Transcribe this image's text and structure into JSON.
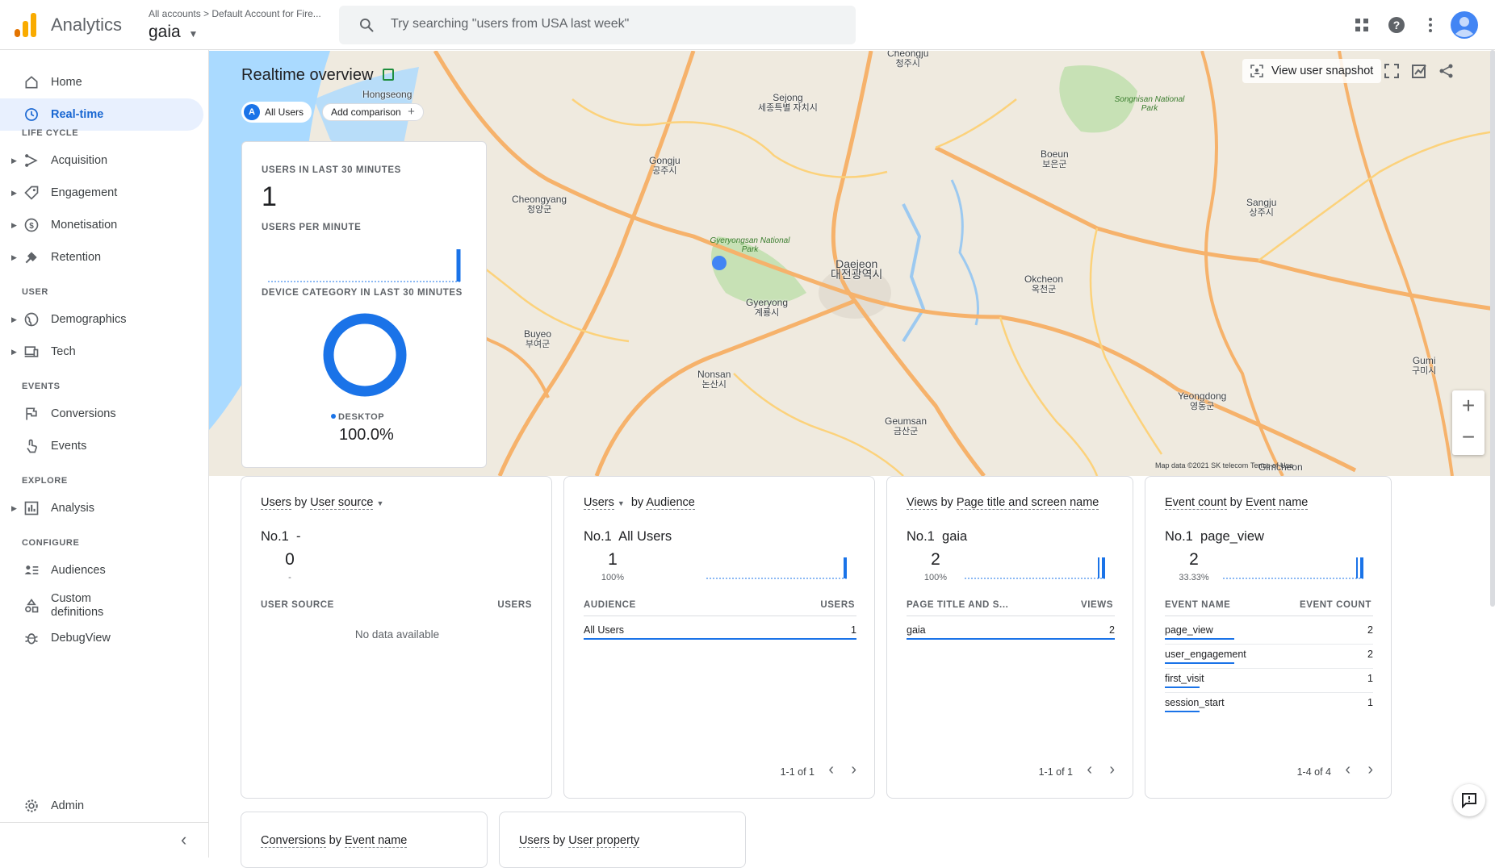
{
  "app": {
    "title": "Analytics",
    "breadcrumb": "All accounts  >  Default Account for Fire...",
    "property": "gaia",
    "search_placeholder": "Try searching \"users from USA last week\""
  },
  "colors": {
    "accent": "#1a73e8",
    "active_bg": "#e8f0fe",
    "logo_orange": "#f9ab00",
    "logo_dark": "#e37400"
  },
  "sidebar": {
    "items": [
      {
        "label": "Home",
        "icon": "home-icon"
      },
      {
        "label": "Real-time",
        "icon": "clock-icon",
        "active": true
      }
    ],
    "sections": [
      {
        "label": "LIFE CYCLE",
        "items": [
          {
            "label": "Acquisition",
            "icon": "acquisition-icon"
          },
          {
            "label": "Engagement",
            "icon": "engagement-icon"
          },
          {
            "label": "Monetisation",
            "icon": "monetisation-icon"
          },
          {
            "label": "Retention",
            "icon": "retention-icon"
          }
        ]
      },
      {
        "label": "USER",
        "items": [
          {
            "label": "Demographics",
            "icon": "globe-icon"
          },
          {
            "label": "Tech",
            "icon": "devices-icon"
          }
        ]
      },
      {
        "label": "EVENTS",
        "items": [
          {
            "label": "Conversions",
            "icon": "flag-icon"
          },
          {
            "label": "Events",
            "icon": "touch-icon"
          }
        ]
      },
      {
        "label": "EXPLORE",
        "items": [
          {
            "label": "Analysis",
            "icon": "analysis-icon"
          }
        ]
      },
      {
        "label": "CONFIGURE",
        "items": [
          {
            "label": "Audiences",
            "icon": "audiences-icon"
          },
          {
            "label": "Custom\ndefinitions",
            "icon": "custom-definitions-icon"
          },
          {
            "label": "DebugView",
            "icon": "bug-icon"
          }
        ]
      }
    ],
    "admin": "Admin"
  },
  "overview": {
    "title": "Realtime overview",
    "chip_letter": "A",
    "chip_label": "All Users",
    "add_comparison": "Add comparison",
    "view_snapshot": "View user snapshot"
  },
  "map": {
    "places": [
      [
        "Cheongju",
        "청주시"
      ],
      [
        "Sejong",
        "세종특별 자치시"
      ],
      [
        "Hongseong",
        ""
      ],
      [
        "Gongju",
        "공주시"
      ],
      [
        "Cheongyang",
        "청양군"
      ],
      [
        "Daejeon",
        "대전광역시"
      ],
      [
        "Buyeo",
        "부여군"
      ],
      [
        "Nonsan",
        "논산시"
      ],
      [
        "Boeun",
        "보은군"
      ],
      [
        "Sangju",
        "상주시"
      ],
      [
        "Okcheon",
        "옥천군"
      ],
      [
        "Yeongdong",
        "영동군"
      ],
      [
        "Geumsan",
        "금산군"
      ],
      [
        "Gumi",
        "구미시"
      ],
      [
        "Gimcheon",
        ""
      ],
      [
        "Gyeryong",
        "계룡시"
      ]
    ],
    "parks": [
      "Gyeryongsan National Park",
      "Songnisan National Park"
    ],
    "attribution": "Map data ©2021 SK telecom",
    "terms": "Terms of Use"
  },
  "realtime_card": {
    "users_heading": "USERS IN LAST 30 MINUTES",
    "users_value": "1",
    "per_minute_heading": "USERS PER MINUTE",
    "per_minute_series": [
      0,
      0,
      0,
      0,
      0,
      0,
      0,
      0,
      0,
      0,
      0,
      0,
      0,
      0,
      0,
      0,
      0,
      0,
      0,
      0,
      0,
      0,
      0,
      0,
      0,
      0,
      0,
      0,
      0,
      1
    ],
    "device_heading": "DEVICE CATEGORY IN LAST 30 MINUTES",
    "device_label": "DESKTOP",
    "device_value": "100.0%",
    "device_fraction": 1.0
  },
  "cards": [
    {
      "title_metric": "Users",
      "title_by": "by",
      "title_dim": "User source",
      "top_rank": "No.1",
      "top_name": "-",
      "top_value": "0",
      "top_pct": "-",
      "col1": "USER SOURCE",
      "col2": "USERS",
      "empty": "No data available",
      "rows": [],
      "pager": ""
    },
    {
      "title_metric": "Users",
      "title_by": "by",
      "title_dim": "Audience",
      "top_rank": "No.1",
      "top_name": "All Users",
      "top_value": "1",
      "top_pct": "100%",
      "col1": "AUDIENCE",
      "col2": "USERS",
      "rows": [
        {
          "name": "All Users",
          "value": "1",
          "share": 1.0
        }
      ],
      "pager": "1-1 of 1"
    },
    {
      "title_metric": "Views",
      "title_by": "by",
      "title_dim": "Page title and screen name",
      "top_rank": "No.1",
      "top_name": "gaia",
      "top_value": "2",
      "top_pct": "100%",
      "col1": "PAGE TITLE AND S...",
      "col2": "VIEWS",
      "rows": [
        {
          "name": "gaia",
          "value": "2",
          "share": 1.0
        }
      ],
      "pager": "1-1 of 1"
    },
    {
      "title_metric": "Event count",
      "title_by": "by",
      "title_dim": "Event name",
      "top_rank": "No.1",
      "top_name": "page_view",
      "top_value": "2",
      "top_pct": "33.33%",
      "col1": "EVENT NAME",
      "col2": "EVENT COUNT",
      "rows": [
        {
          "name": "page_view",
          "value": "2",
          "share": 0.333
        },
        {
          "name": "user_engagement",
          "value": "2",
          "share": 0.333
        },
        {
          "name": "first_visit",
          "value": "1",
          "share": 0.167
        },
        {
          "name": "session_start",
          "value": "1",
          "share": 0.167
        }
      ],
      "pager": "1-4 of 4"
    }
  ],
  "bottom_cards": [
    {
      "title_metric": "Conversions",
      "title_by": "by",
      "title_dim": "Event name"
    },
    {
      "title_metric": "Users",
      "title_by": "by",
      "title_dim": "User property"
    }
  ]
}
